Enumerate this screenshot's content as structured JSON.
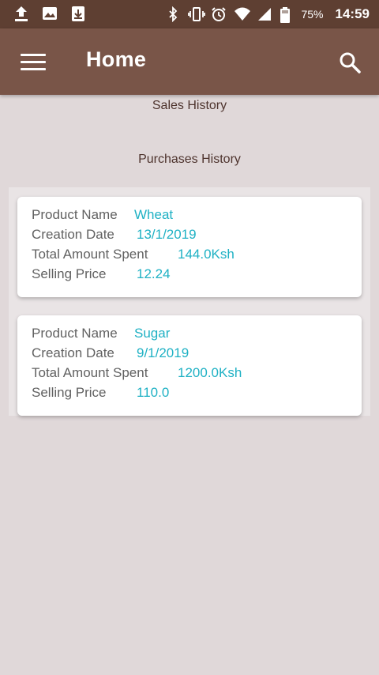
{
  "status_bar": {
    "battery": "75%",
    "time": "14:59",
    "left_icons": [
      "upload-icon",
      "image-icon",
      "download-icon"
    ],
    "right_icons": [
      "bluetooth-icon",
      "vibrate-icon",
      "alarm-icon",
      "wifi-icon",
      "signal-icon",
      "battery-icon"
    ]
  },
  "app_bar": {
    "title": "Home",
    "background": "#795548",
    "menu_icon": "menu-icon",
    "search_icon": "search-icon"
  },
  "sections": {
    "sales_history": "Sales History",
    "purchases_history": "Purchases History"
  },
  "purchases": [
    {
      "product_name_label": "Product Name",
      "product_name": "Wheat",
      "creation_date_label": "Creation Date",
      "creation_date": "13/1/2019",
      "total_amount_label": "Total Amount Spent",
      "total_amount": "144.0Ksh",
      "selling_price_label": "Selling Price",
      "selling_price": "12.24"
    },
    {
      "product_name_label": "Product Name",
      "product_name": "Sugar",
      "creation_date_label": "Creation Date",
      "creation_date": "9/1/2019",
      "total_amount_label": "Total Amount Spent",
      "total_amount": "1200.0Ksh",
      "selling_price_label": "Selling Price",
      "selling_price": "110.0"
    }
  ],
  "colors": {
    "status_bar": "#5e3f32",
    "value_text": "#1fb1c4",
    "label_text": "#616161",
    "page_background": "#e0d8d9"
  }
}
